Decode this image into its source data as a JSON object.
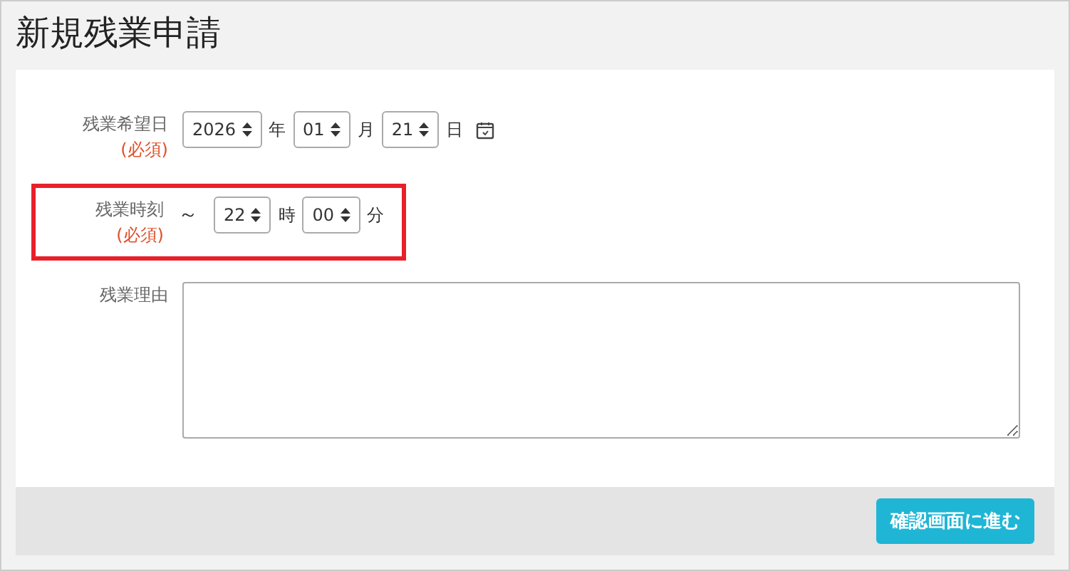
{
  "title": "新規残業申請",
  "date_field": {
    "label": "残業希望日",
    "required": "(必須)",
    "parts": [
      {
        "value": "2026",
        "unit": "年"
      },
      {
        "value": "01",
        "unit": "月"
      },
      {
        "value": "21",
        "unit": "日"
      }
    ]
  },
  "time_field": {
    "label": "残業時刻",
    "required": "(必須)",
    "prefix": "～",
    "highlighted": true,
    "parts": [
      {
        "value": "22",
        "unit": "時"
      },
      {
        "value": "00",
        "unit": "分"
      }
    ]
  },
  "reason_field": {
    "label": "残業理由"
  },
  "submit_button": "確認画面に進む"
}
